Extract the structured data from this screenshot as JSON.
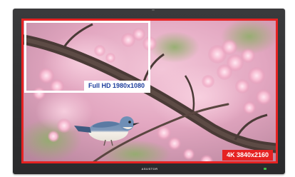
{
  "monitor": {
    "brand": "ASUSTOR",
    "screen": {
      "image_subject": "bird-on-cherry-blossom-branch",
      "outer_frame": {
        "label": "4K 3840x2160",
        "color": "#e52222"
      },
      "inner_frame": {
        "label": "Full HD 1980x1080",
        "color": "#ffffff",
        "label_text_color": "#1c3d9c"
      }
    },
    "power_led_color": "#3fbf4a"
  }
}
